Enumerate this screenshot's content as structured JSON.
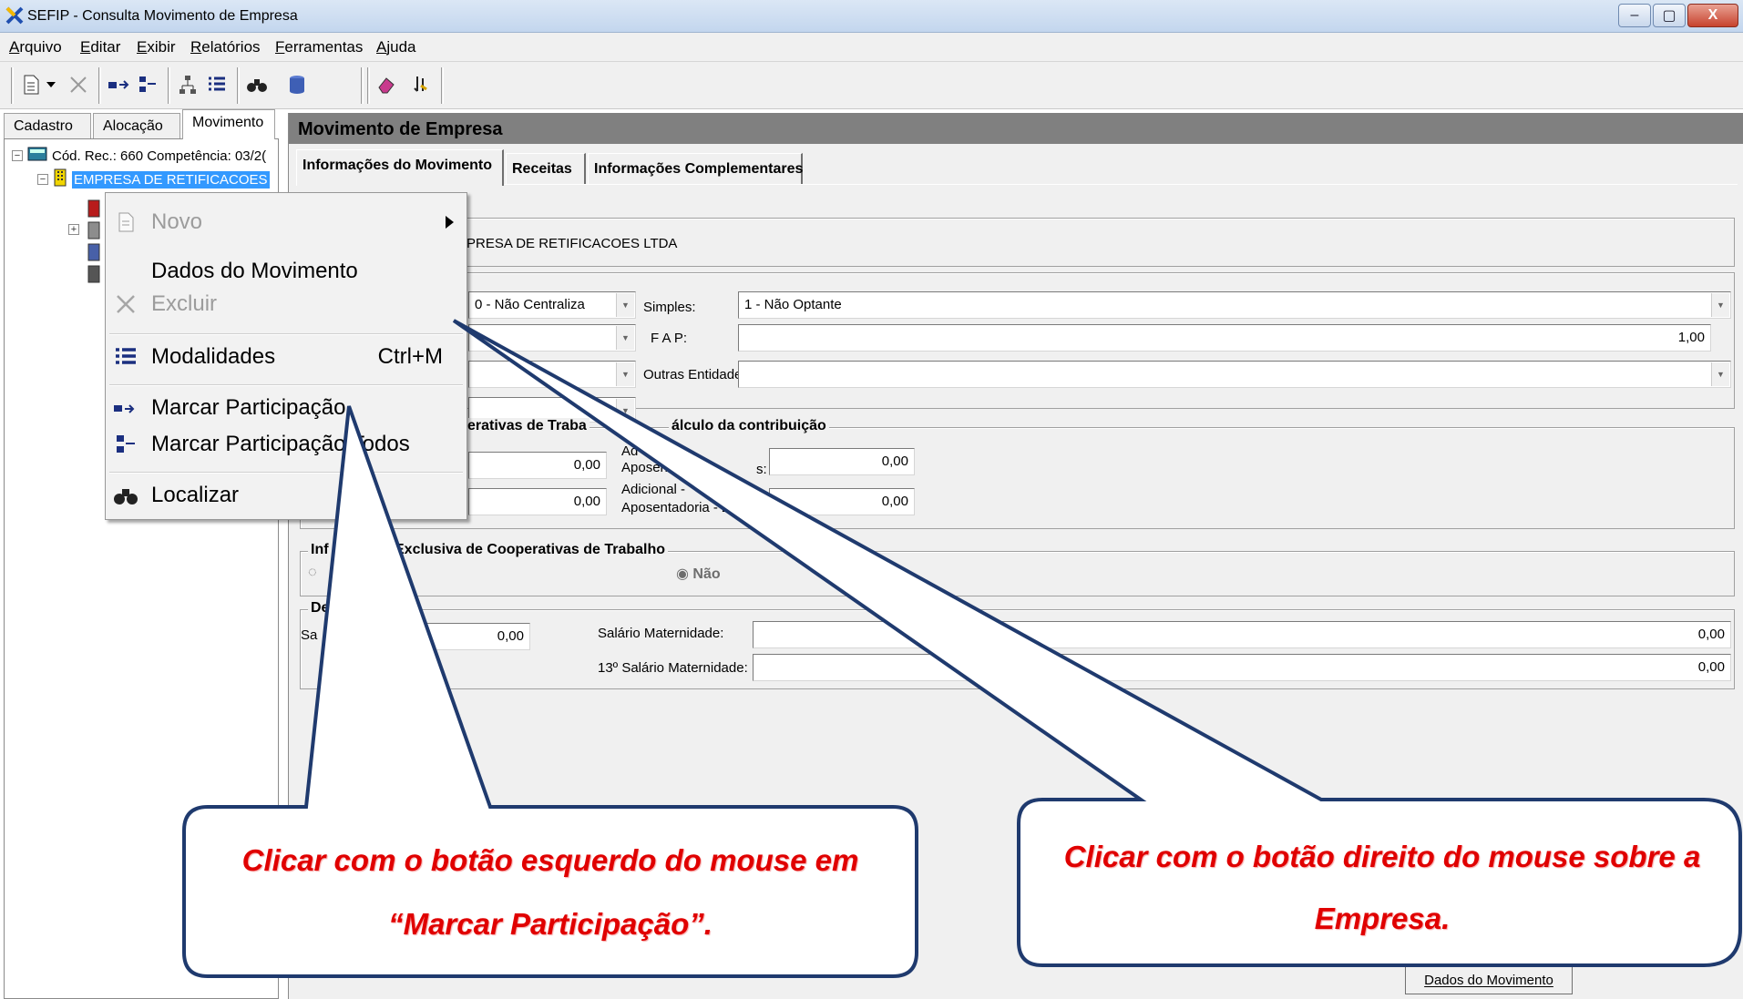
{
  "window": {
    "title": "SEFIP - Consulta Movimento de Empresa",
    "minimize": "–",
    "restore": "▢",
    "close": "X"
  },
  "menubar": [
    {
      "first": "A",
      "rest": "rquivo"
    },
    {
      "first": "E",
      "rest": "ditar"
    },
    {
      "first": "E",
      "rest": "xibir"
    },
    {
      "first": "R",
      "rest": "elatórios"
    },
    {
      "first": "F",
      "rest": "erramentas"
    },
    {
      "first": "A",
      "rest": "juda"
    }
  ],
  "toolbar": [
    "new-icon",
    "dropdown-arrow-icon",
    "delete-icon",
    "mark-icon",
    "mark-all-icon",
    "tree-icon",
    "list-icon",
    "binoculars-icon",
    "database-icon",
    "eraser-icon",
    "run-icon"
  ],
  "left_tabs": [
    "Cadastro",
    "Alocação",
    "Movimento"
  ],
  "tree": {
    "root": "Cód. Rec.: 660 Competência: 03/2(",
    "company": "EMPRESA DE RETIFICACOES"
  },
  "context_menu": {
    "novo": "Novo",
    "dados": "Dados do Movimento",
    "excluir": "Excluir",
    "modalidades": "Modalidades",
    "modalidades_shortcut": "Ctrl+M",
    "marcar": "Marcar Participação",
    "marcar_todos": "Marcar Participação Todos",
    "localizar": "Localizar"
  },
  "panel": {
    "header": "Movimento de Empresa",
    "tabs": [
      "Informações do Movimento",
      "Receitas",
      "Informações Complementares"
    ],
    "company_name": "PRESA DE RETIFICACOES LTDA",
    "centraliza": "0 - Não Centraliza",
    "simples_label": "Simples:",
    "simples_value": "1 - Não Optante",
    "fap_label": "F A P:",
    "fap_value": "1,00",
    "outras_label": "Outras Entidades:",
    "outras_value": "",
    "coop_group_title": "erativas de Traba",
    "coop_group_title_tail": "álculo da contribuição",
    "coop_val1": "0,00",
    "coop_val2": "0,00",
    "adic_label1_a": "Ad",
    "adic_label1_b": "Aposen",
    "adic_label1_c": "s:",
    "adic_label2_a": "Adicional -",
    "adic_label2_b": "Aposentadoria - 2",
    "adic_val1": "0,00",
    "adic_val2": "0,00",
    "excl_title_a": "Inf",
    "excl_title_b": "Exclusiva de Cooperativas de Trabalho",
    "radio_nao": "Não",
    "ded_title": "De",
    "ded_label": "Sa",
    "ded_val": "0,00",
    "sal_mat_label": "Salário Maternidade:",
    "sal_mat_value": "0,00",
    "sal13_label": "13º Salário Maternidade:",
    "sal13_value": "0,00",
    "bottom_button": "Dados do Movimento"
  },
  "callouts": {
    "left_line1": "Clicar com o botão esquerdo do mouse em",
    "left_line2": "“Marcar Participação”.",
    "right_line1": "Clicar com o botão direito do mouse sobre a",
    "right_line2": "Empresa."
  },
  "colors": {
    "callout_text": "#e00000",
    "callout_border": "#1f3a6e",
    "selection": "#3399ff"
  }
}
